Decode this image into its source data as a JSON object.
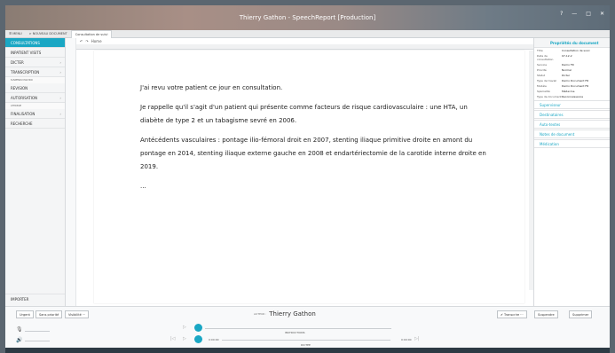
{
  "window": {
    "title": "Thierry Gathon - SpeechReport [Production]",
    "controls": [
      "?",
      "—",
      "□",
      "✕"
    ]
  },
  "menubar": {
    "menu": "☰ MENU",
    "breadcrumb": "> NOUVEAU DOCUMENT",
    "tab": "Consultation de suivi"
  },
  "sidebar": {
    "items": [
      {
        "label": "CONSULTATIONS",
        "active": true
      },
      {
        "label": "INPATIENT VISITS"
      },
      {
        "label": "DICTER"
      },
      {
        "label": "TRANSCRIPTION"
      },
      {
        "label": "REVISION"
      },
      {
        "label": "AUTORISATION"
      },
      {
        "label": "FINALISATION"
      },
      {
        "label": "RECHERCHE"
      }
    ],
    "sub_transcription": "SUSPENDU PAR MOI",
    "sub_autorisation": "ATTRIBUE",
    "importer": "IMPORTER"
  },
  "editor": {
    "home": "Home",
    "paragraphs": [
      "J'ai revu votre patient ce jour en consultation.",
      "Je rappelle qu'il s'agit d'un patient qui présente comme facteurs de risque cardiovasculaire : une HTA, un diabète de type 2 et un tabagisme sevré en 2006.",
      "Antécédents vasculaires : pontage ilio-fémoral droit en 2007, stenting iliaque primitive droite en amont du pontage en 2014, stenting iliaque externe gauche en 2008 et endartériectomie de la carotide interne droite en 2019.",
      "..."
    ]
  },
  "rightpanel": {
    "header": "Propriétés du document",
    "props": [
      {
        "k": "Titre",
        "v": "Consultation de suivi"
      },
      {
        "k": "Date de consultation",
        "v": "07-12-2"
      },
      {
        "k": "Service",
        "v": "Demo FR"
      },
      {
        "k": "Priorité",
        "v": "Normal"
      },
      {
        "k": "Statut",
        "v": "Dicter"
      },
      {
        "k": "Type de travail",
        "v": "Demo Document FR"
      },
      {
        "k": "Modèle",
        "v": "Demo Document FR"
      },
      {
        "k": "Spécialité",
        "v": "Médecine"
      },
      {
        "k": "Type de document",
        "v": "Reconnaissance"
      }
    ],
    "sections": [
      "Superviseur",
      "Destinataires",
      "Auto-textes",
      "Notes de document",
      "Médication"
    ]
  },
  "bottom": {
    "urgent": "Urgent",
    "priority": "Sans priorité",
    "visibility": "Visibilité ···",
    "author_label": "AUTEUR :",
    "author": "Thierry Gathon",
    "transcrire": "✔ Transcrire ···",
    "suspendre": "Suspendre",
    "supprimer": "Supprimer",
    "instructions": "INSTRUCTIONS",
    "dictee": "DICTEE",
    "time_start": "0:00:00",
    "time_end": "0:00:00"
  },
  "colors": {
    "accent": "#1aa7c4"
  }
}
